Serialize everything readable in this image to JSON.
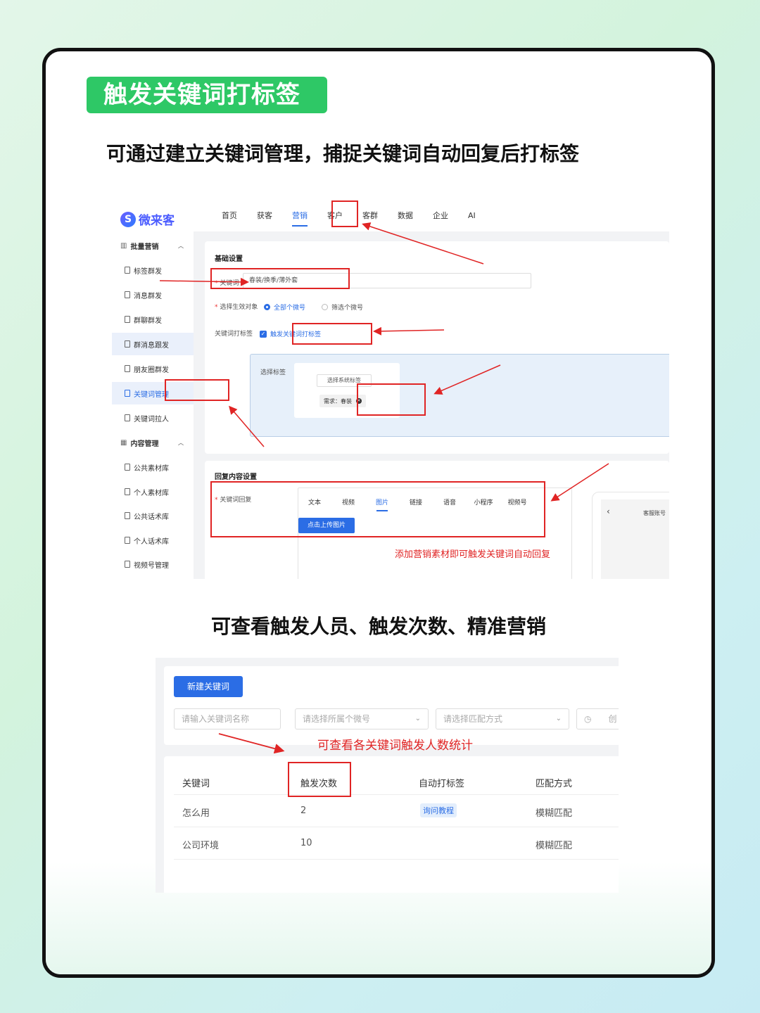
{
  "header": {
    "tag_title": "触发关键词打标签",
    "subtitle_1": "可通过建立关键词管理，捕捉关键词自动回复后打标签",
    "subtitle_2": "可查看触发人员、触发次数、精准营销"
  },
  "app": {
    "logo_text": "微来客",
    "nav": [
      "首页",
      "获客",
      "营销",
      "客户",
      "客群",
      "数据",
      "企业",
      "AI"
    ],
    "nav_active": "营销",
    "sidebar": {
      "group_marketing": "批量营销",
      "items_marketing": [
        "标签群发",
        "消息群发",
        "群聊群发",
        "群消息跟发",
        "朋友圈群发",
        "关键词管理",
        "关键词拉人"
      ],
      "group_content": "内容管理",
      "items_content": [
        "公共素材库",
        "个人素材库",
        "公共话术库",
        "个人话术库",
        "视频号管理"
      ]
    },
    "form": {
      "basic_title": "基础设置",
      "keyword_label": "关键词",
      "keyword_value": "春装/换季/薄外套",
      "target_label": "选择生效对象",
      "radio_all": "全部个微号",
      "radio_filter": "筛选个微号",
      "tagging_label": "关键词打标签",
      "tagging_checkbox": "触发关键词打标签",
      "select_tag_label": "选择标签",
      "select_sys_tag_btn": "选择系统标签",
      "tag_chip": "需求：春装",
      "reply_title": "回复内容设置",
      "reply_label": "关键词回复",
      "reply_tabs": [
        "文本",
        "视频",
        "图片",
        "链接",
        "语音",
        "小程序",
        "视频号"
      ],
      "reply_tab_active": "图片",
      "upload_btn": "点击上传图片",
      "phone_title": "客服账号",
      "note": "添加营销素材即可触发关键词自动回复"
    }
  },
  "stats": {
    "new_btn": "新建关键词",
    "filter_name_ph": "请输入关键词名称",
    "filter_account_ph": "请选择所属个微号",
    "filter_match_ph": "请选择匹配方式",
    "filter_date_ph": "创",
    "note": "可查看各关键词触发人数统计",
    "columns": [
      "关键词",
      "触发次数",
      "自动打标签",
      "匹配方式"
    ],
    "rows": [
      {
        "keyword": "怎么用",
        "count": "2",
        "tag": "询问教程",
        "match": "模糊匹配"
      },
      {
        "keyword": "公司环境",
        "count": "10",
        "tag": "",
        "match": "模糊匹配"
      }
    ]
  },
  "colors": {
    "green": "#2ec866",
    "blue": "#2b6de5",
    "red": "#e02424"
  }
}
